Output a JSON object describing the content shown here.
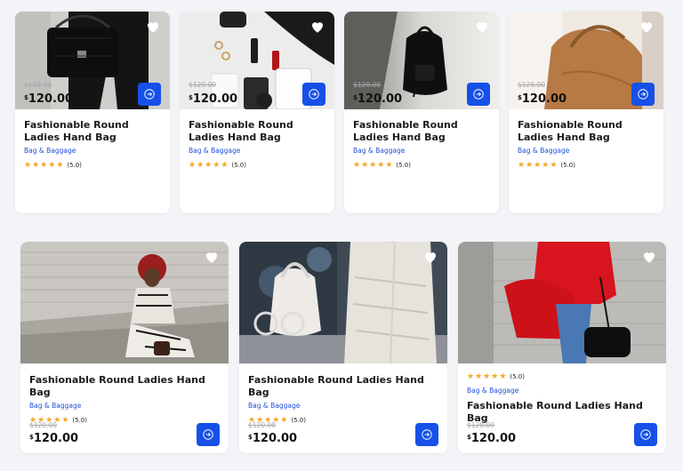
{
  "accent_color": "#1650e8",
  "star_color": "#f5a623",
  "products": [
    {
      "title": "Fashionable Round Ladies Hand Bag",
      "category": "Bag & Baggage",
      "rating": "(5.0)",
      "old_price": "120.00",
      "price": "120.00",
      "currency": "$",
      "image": "black-quilted-handbag-photo"
    },
    {
      "title": "Fashionable Round Ladies Hand Bag",
      "category": "Bag & Baggage",
      "rating": "(5.0)",
      "old_price": "120.00",
      "price": "120.00",
      "currency": "$",
      "image": "accessories-flatlay-photo"
    },
    {
      "title": "Fashionable Round Ladies Hand Bag",
      "category": "Bag & Baggage",
      "rating": "(5.0)",
      "old_price": "120.00",
      "price": "120.00",
      "currency": "$",
      "image": "black-backpack-photo"
    },
    {
      "title": "Fashionable Round Ladies Hand Bag",
      "category": "Bag & Baggage",
      "rating": "(5.0)",
      "old_price": "120.00",
      "price": "120.00",
      "currency": "$",
      "image": "tan-leather-bag-photo"
    },
    {
      "title": "Fashionable Round Ladies Hand Bag",
      "category": "Bag & Baggage",
      "rating": "(5.0)",
      "old_price": "120.00",
      "price": "120.00",
      "currency": "$",
      "image": "woman-on-steps-photo"
    },
    {
      "title": "Fashionable Round Ladies Hand Bag",
      "category": "Bag & Baggage",
      "rating": "(5.0)",
      "old_price": "120.00",
      "price": "120.00",
      "currency": "$",
      "image": "white-handbag-photo"
    },
    {
      "title": "Fashionable Round Ladies Hand Bag",
      "category": "Bag & Baggage",
      "rating": "(5.0)",
      "old_price": "120.00",
      "price": "120.00",
      "currency": "$",
      "image": "red-coat-handbag-photo"
    }
  ]
}
